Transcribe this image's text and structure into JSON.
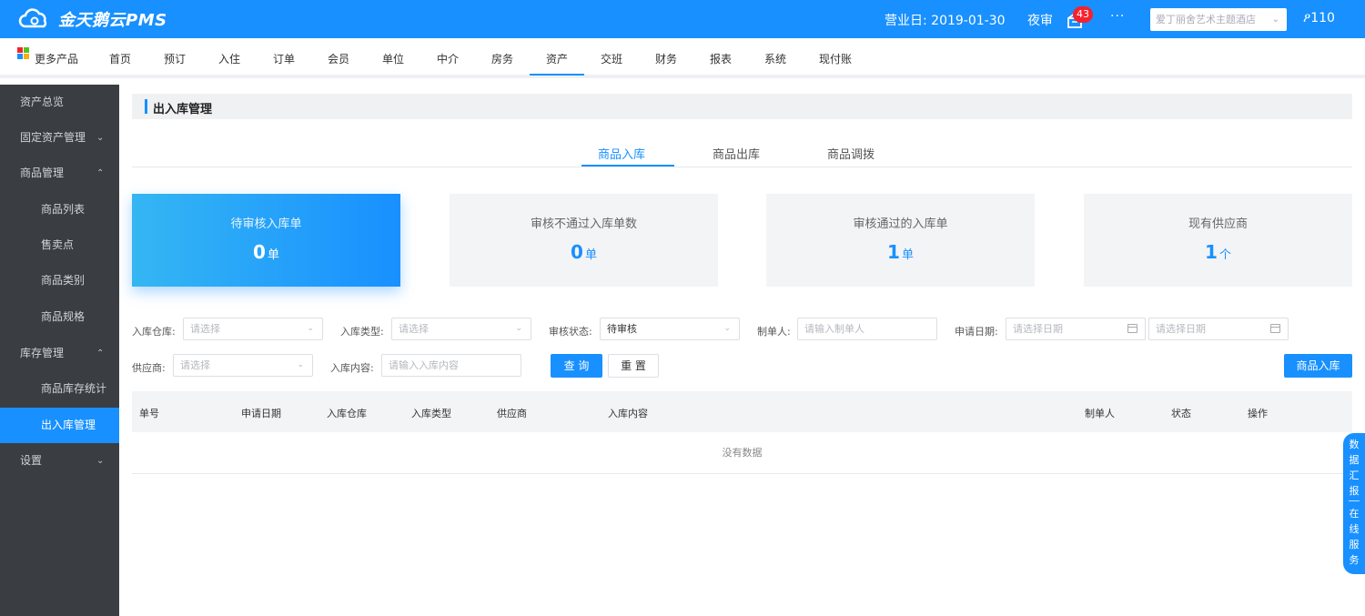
{
  "header": {
    "brand": "金天鹅云PMS",
    "business_date": "营业日: 2019-01-30",
    "night_audit": "夜审",
    "notification_count": "43",
    "more": "···",
    "hotel_placeholder": "爱丁丽舍艺术主题酒店",
    "user": "ዖ110",
    "colors": {
      "primary": "#1890ff",
      "sidebar": "#3a3d42",
      "badge": "#f5222d"
    }
  },
  "nav": {
    "more_products": "更多产品",
    "items": [
      "首页",
      "预订",
      "入住",
      "订单",
      "会员",
      "单位",
      "中介",
      "房务",
      "资产",
      "交班",
      "财务",
      "报表",
      "系统",
      "现付账"
    ],
    "active": "资产"
  },
  "sidebar": {
    "items": [
      {
        "label": "资产总览",
        "level": 1,
        "arrow": ""
      },
      {
        "label": "固定资产管理",
        "level": 1,
        "arrow": "⌄"
      },
      {
        "label": "商品管理",
        "level": 1,
        "arrow": "⌃"
      },
      {
        "label": "商品列表",
        "level": 2,
        "arrow": ""
      },
      {
        "label": "售卖点",
        "level": 2,
        "arrow": ""
      },
      {
        "label": "商品类别",
        "level": 2,
        "arrow": ""
      },
      {
        "label": "商品规格",
        "level": 2,
        "arrow": ""
      },
      {
        "label": "库存管理",
        "level": 1,
        "arrow": "⌃"
      },
      {
        "label": "商品库存统计",
        "level": 2,
        "arrow": ""
      },
      {
        "label": "出入库管理",
        "level": 2,
        "arrow": "",
        "active": true
      },
      {
        "label": "设置",
        "level": 1,
        "arrow": "⌄"
      }
    ]
  },
  "page": {
    "title": "出入库管理",
    "tabs": [
      "商品入库",
      "商品出库",
      "商品调拨"
    ],
    "active_tab": "商品入库"
  },
  "cards": [
    {
      "label": "待审核入库单",
      "value": "0",
      "unit": "单"
    },
    {
      "label": "审核不通过入库单数",
      "value": "0",
      "unit": "单"
    },
    {
      "label": "审核通过的入库单",
      "value": "1",
      "unit": "单"
    },
    {
      "label": "现有供应商",
      "value": "1",
      "unit": "个"
    }
  ],
  "filters": {
    "warehouse_label": "入库仓库:",
    "warehouse_placeholder": "请选择",
    "type_label": "入库类型:",
    "type_placeholder": "请选择",
    "status_label": "审核状态:",
    "status_value": "待审核",
    "creator_label": "制单人:",
    "creator_placeholder": "请输入制单人",
    "date_label": "申请日期:",
    "date_start_placeholder": "请选择日期",
    "date_end_placeholder": "请选择日期",
    "supplier_label": "供应商:",
    "supplier_placeholder": "请选择",
    "content_label": "入库内容:",
    "content_placeholder": "请输入入库内容",
    "search_button": "查 询",
    "reset_button": "重 置",
    "add_button": "商品入库"
  },
  "table": {
    "columns": [
      "单号",
      "申请日期",
      "入库仓库",
      "入库类型",
      "供应商",
      "入库内容",
      "制单人",
      "状态",
      "操作"
    ],
    "empty_text": "没有数据"
  },
  "float_panel": {
    "report_chars": [
      "数",
      "据",
      "汇",
      "报"
    ],
    "service_chars": [
      "在",
      "线",
      "服",
      "务"
    ]
  }
}
